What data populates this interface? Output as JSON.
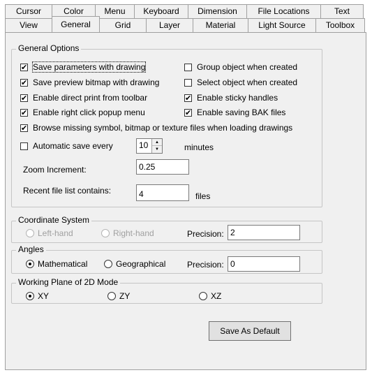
{
  "tabs": {
    "row1": [
      "Cursor",
      "Color",
      "Menu",
      "Keyboard",
      "Dimension",
      "File Locations",
      "Text"
    ],
    "row2": [
      "View",
      "General",
      "Grid",
      "Layer",
      "Material",
      "Light Source",
      "Toolbox"
    ],
    "active": "General"
  },
  "general_options": {
    "title": "General Options",
    "save_params": "Save parameters with drawing",
    "save_preview": "Save preview bitmap with drawing",
    "direct_print": "Enable direct print from toolbar",
    "right_click": "Enable right click popup menu",
    "browse_missing": "Browse missing symbol, bitmap or texture files when loading drawings",
    "group_object": "Group object when created",
    "select_object": "Select object when created",
    "sticky_handles": "Enable sticky handles",
    "saving_bak": "Enable saving BAK files",
    "auto_save_label": "Automatic save every",
    "auto_save_value": "10",
    "minutes_label": "minutes",
    "zoom_label": "Zoom Increment:",
    "zoom_value": "0.25",
    "recent_label": "Recent file list contains:",
    "recent_value": "4",
    "files_label": "files",
    "checked": {
      "save_params": true,
      "save_preview": true,
      "direct_print": true,
      "right_click": true,
      "browse_missing": true,
      "group_object": false,
      "select_object": false,
      "sticky_handles": true,
      "saving_bak": true,
      "auto_save": false
    }
  },
  "coordinate_system": {
    "title": "Coordinate System",
    "left_hand": "Left-hand",
    "right_hand": "Right-hand",
    "precision_label": "Precision:",
    "precision_value": "2"
  },
  "angles": {
    "title": "Angles",
    "mathematical": "Mathematical",
    "geographical": "Geographical",
    "precision_label": "Precision:",
    "precision_value": "0",
    "selected": "Mathematical"
  },
  "working_plane": {
    "title": "Working Plane of 2D Mode",
    "xy": "XY",
    "zy": "ZY",
    "xz": "XZ",
    "selected": "XY"
  },
  "buttons": {
    "save_default": "Save As Default"
  }
}
